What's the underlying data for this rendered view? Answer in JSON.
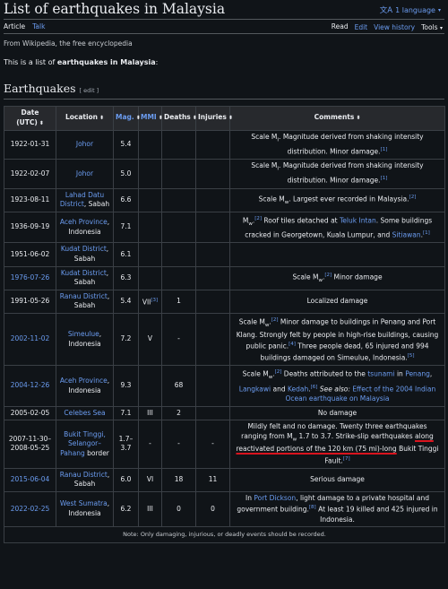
{
  "page": {
    "title": "List of earthquakes in Malaysia",
    "language_button": "1 language",
    "tabs_left": [
      "Article",
      "Talk"
    ],
    "tabs_right": [
      "Read",
      "Edit",
      "View history",
      "Tools"
    ],
    "from": "From Wikipedia, the free encyclopedia",
    "intro_prefix": "This is a list of ",
    "intro_bold": "earthquakes in Malaysia",
    "intro_suffix": ":",
    "section": "Earthquakes",
    "section_edit": "[ edit ]"
  },
  "table": {
    "headers": [
      "Date (UTC)",
      "Location",
      "Mag.",
      "MMI",
      "Deaths",
      "Injuries",
      "Comments"
    ],
    "rows": [
      {
        "date": "1922-01-31",
        "date_link": false,
        "loc": "Johor",
        "mag": "5.4",
        "mmi": "",
        "deaths": "",
        "injuries": "",
        "comments": "Scale M_I. Magnitude derived from shaking intensity distribution. Minor damage.[1]"
      },
      {
        "date": "1922-02-07",
        "date_link": false,
        "loc": "Johor",
        "mag": "5.0",
        "mmi": "",
        "deaths": "",
        "injuries": "",
        "comments": "Scale M_I. Magnitude derived from shaking intensity distribution. Minor damage.[1]"
      },
      {
        "date": "1923-08-11",
        "date_link": false,
        "loc": "Lahad Datu District, Sabah",
        "mag": "6.6",
        "mmi": "",
        "deaths": "",
        "injuries": "",
        "comments": "Scale M_w. Largest ever recorded in Malaysia.[2]"
      },
      {
        "date": "1936-09-19",
        "date_link": false,
        "loc": "Aceh Province, Indonesia",
        "mag": "7.1",
        "mmi": "",
        "deaths": "",
        "injuries": "",
        "comments": "M_w.[2] Roof tiles detached at Teluk Intan. Some buildings cracked in Georgetown, Kuala Lumpur, and Sitiawan.[1]"
      },
      {
        "date": "1951-06-02",
        "date_link": false,
        "loc": "Kudat District, Sabah",
        "mag": "6.1",
        "mmi": "",
        "deaths": "",
        "injuries": "",
        "comments": ""
      },
      {
        "date": "1976-07-26",
        "date_link": true,
        "loc": "Kudat District, Sabah",
        "mag": "6.3",
        "mmi": "",
        "deaths": "",
        "injuries": "",
        "comments": "Scale M_w.[2] Minor damage"
      },
      {
        "date": "1991-05-26",
        "date_link": false,
        "loc": "Ranau District, Sabah",
        "mag": "5.4",
        "mmi": "VII[3]",
        "deaths": "1",
        "injuries": "",
        "comments": "Localized damage"
      },
      {
        "date": "2002-11-02",
        "date_link": true,
        "loc": "Simeulue, Indonesia",
        "mag": "7.2",
        "mmi": "V",
        "deaths": "-",
        "injuries": "",
        "comments": "Scale M_w.[2] Minor damage to buildings in Penang and Port Klang. Strongly felt by people in high-rise buildings, causing public panic.[4] Three people dead, 65 injured and 994 buildings damaged on Simeulue, Indonesia.[5]"
      },
      {
        "date": "2004-12-26",
        "date_link": true,
        "loc": "Aceh Province, Indonesia",
        "mag": "9.3",
        "mmi": "",
        "deaths": "68",
        "injuries": "",
        "comments": "Scale M_w.[2] Deaths attributed to the tsunami in Penang, Langkawi and Kedah.[6] See also: Effect of the 2004 Indian Ocean earthquake on Malaysia"
      },
      {
        "date": "2005-02-05",
        "date_link": false,
        "loc": "Celebes Sea",
        "mag": "7.1",
        "mmi": "III",
        "deaths": "2",
        "injuries": "",
        "comments": "No damage"
      },
      {
        "date": "2007-11-30– 2008-05-25",
        "date_link": false,
        "loc": "Bukit Tinggi, Selangor– Pahang border",
        "mag": "1.7– 3.7",
        "mmi": "-",
        "deaths": "-",
        "injuries": "-",
        "comments": "Mildly felt and no damage. Twenty three earthquakes ranging from M_w 1.7 to 3.7. Strike-slip earthquakes along reactivated portions of the 120 km (75 mi)-long Bukit Tinggi Fault.[7]"
      },
      {
        "date": "2015-06-04",
        "date_link": true,
        "loc": "Ranau District, Sabah",
        "mag": "6.0",
        "mmi": "VI",
        "deaths": "18",
        "injuries": "11",
        "comments": "Serious damage"
      },
      {
        "date": "2022-02-25",
        "date_link": true,
        "loc": "West Sumatra, Indonesia",
        "mag": "6.2",
        "mmi": "III",
        "deaths": "0",
        "injuries": "0",
        "comments": "In Port Dickson, light damage to a private hospital and government building.[8] At least 19 killed and 425 injured in Indonesia."
      }
    ],
    "note": "Note: Only damaging, injurious, or deadly events should be recorded."
  },
  "colors": {
    "background": "#101418",
    "link": "#6b9cf0",
    "header_bg": "#27292d",
    "border": "#3a3f45",
    "annotation_red": "#d9141e"
  },
  "icons": [
    "translate-icon",
    "chevron-down-icon",
    "sort-icon"
  ]
}
